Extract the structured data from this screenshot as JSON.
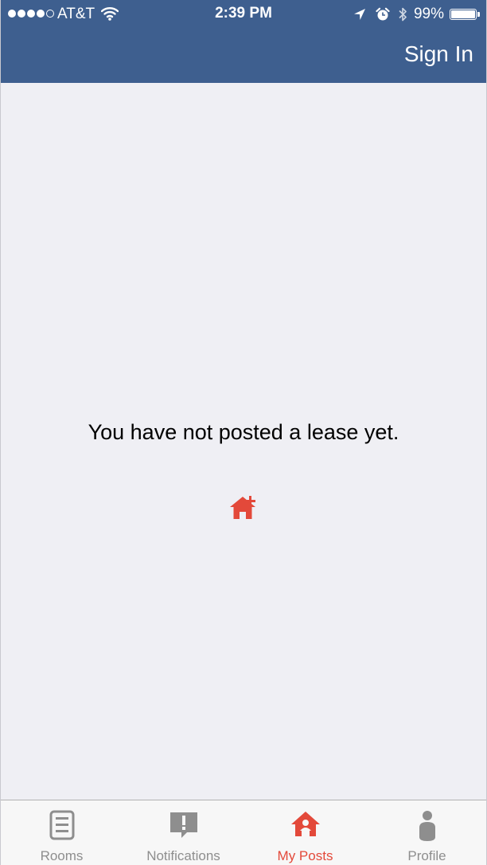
{
  "status_bar": {
    "carrier": "AT&T",
    "time": "2:39 PM",
    "battery_percent": "99%",
    "battery_level": 0.99,
    "signal_bars": 4,
    "signal_bars_total": 5,
    "icons": [
      "signal-dots-icon",
      "wifi-icon",
      "location-arrow-icon",
      "alarm-clock-icon",
      "bluetooth-icon",
      "battery-icon"
    ]
  },
  "nav": {
    "sign_in_label": "Sign In"
  },
  "content": {
    "empty_message": "You have not posted a lease yet.",
    "add_icon": "add-home-icon"
  },
  "tabs": [
    {
      "label": "Rooms",
      "icon": "list-document-icon",
      "active": false
    },
    {
      "label": "Notifications",
      "icon": "alert-bubble-icon",
      "active": false
    },
    {
      "label": "My Posts",
      "icon": "home-person-icon",
      "active": true
    },
    {
      "label": "Profile",
      "icon": "person-icon",
      "active": false
    }
  ],
  "colors": {
    "header_bg": "#3e5f8f",
    "accent": "#e3493a",
    "tab_inactive": "#8e8e8e",
    "content_bg": "#efeff4"
  }
}
